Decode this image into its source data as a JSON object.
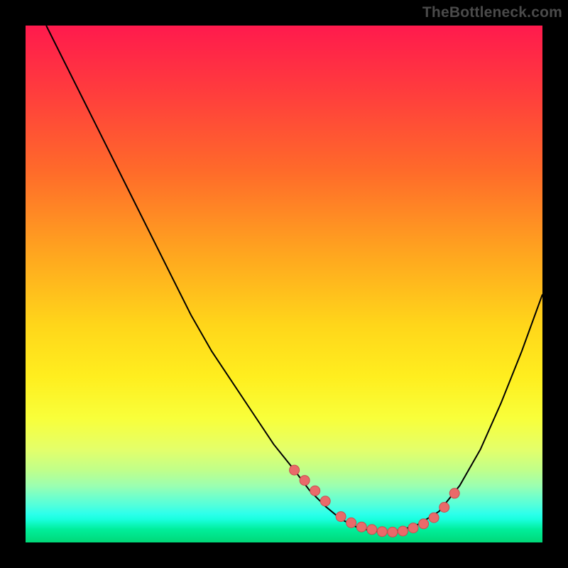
{
  "watermark": "TheBottleneck.com",
  "colors": {
    "marker_fill": "#e96a6a",
    "marker_stroke": "#c94f4f",
    "curve": "#000000"
  },
  "chart_data": {
    "type": "line",
    "title": "",
    "xlabel": "",
    "ylabel": "",
    "xlim": [
      0,
      100
    ],
    "ylim": [
      0,
      100
    ],
    "grid": false,
    "legend": false,
    "series": [
      {
        "name": "bottleneck-curve",
        "x": [
          4,
          8,
          12,
          16,
          20,
          24,
          28,
          32,
          36,
          40,
          44,
          48,
          52,
          55,
          58,
          61,
          64,
          67,
          70,
          73,
          76,
          80,
          84,
          88,
          92,
          96,
          100
        ],
        "y": [
          100,
          92,
          84,
          76,
          68,
          60,
          52,
          44,
          37,
          31,
          25,
          19,
          14,
          10,
          7,
          4.5,
          3,
          2.2,
          2,
          2.5,
          3.5,
          6,
          11,
          18,
          27,
          37,
          48
        ]
      }
    ],
    "markers": {
      "name": "highlight-points",
      "x": [
        52,
        54,
        56,
        58,
        61,
        63,
        65,
        67,
        69,
        71,
        73,
        75,
        77,
        79,
        81,
        83
      ],
      "y": [
        14,
        12,
        10,
        8,
        5,
        3.8,
        3,
        2.5,
        2.1,
        2,
        2.2,
        2.8,
        3.6,
        4.8,
        6.8,
        9.5
      ]
    }
  }
}
